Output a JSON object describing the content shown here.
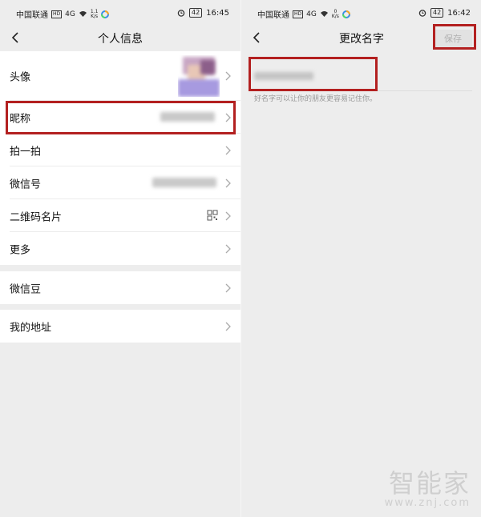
{
  "left": {
    "status": {
      "carrier": "中国联通",
      "hd": "HD",
      "signal": "4G",
      "speed_top": "1.1",
      "speed_bottom": "K/s",
      "battery": "42",
      "time": "16:45"
    },
    "title": "个人信息",
    "rows": [
      {
        "label": "头像"
      },
      {
        "label": "昵称"
      },
      {
        "label": "拍一拍"
      },
      {
        "label": "微信号"
      },
      {
        "label": "二维码名片"
      },
      {
        "label": "更多"
      },
      {
        "label": "微信豆"
      },
      {
        "label": "我的地址"
      }
    ]
  },
  "right": {
    "status": {
      "carrier": "中国联通",
      "hd": "HD",
      "signal": "4G",
      "speed_top": "0",
      "speed_bottom": "K/s",
      "battery": "42",
      "time": "16:42"
    },
    "title": "更改名字",
    "save_label": "保存",
    "hint": "好名字可以让你的朋友更容易记住你。"
  },
  "watermark": {
    "main": "智能家",
    "sub": "www.znj.com"
  },
  "colors": {
    "highlight": "#b32020",
    "background": "#ededed"
  }
}
